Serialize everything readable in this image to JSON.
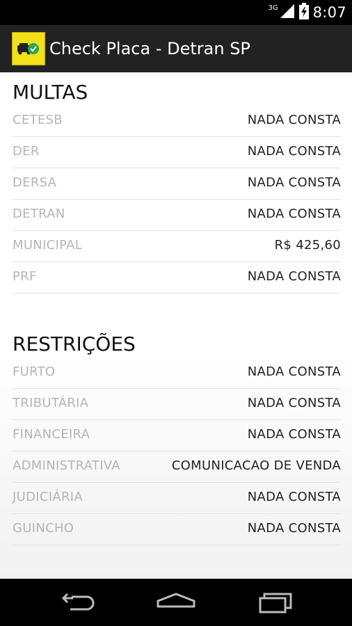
{
  "status_bar": {
    "network": "3G",
    "time": "8:07",
    "icons": [
      "signal-icon",
      "battery-icon"
    ]
  },
  "app_bar": {
    "title": "Check Placa - Detran SP",
    "icon": "car-check-icon",
    "icon_color": "#f2e11a"
  },
  "multas": {
    "title": "MULTAS",
    "rows": [
      {
        "label": "CETESB",
        "value": "NADA CONSTA"
      },
      {
        "label": "DER",
        "value": "NADA CONSTA"
      },
      {
        "label": "DERSA",
        "value": "NADA CONSTA"
      },
      {
        "label": "DETRAN",
        "value": "NADA CONSTA"
      },
      {
        "label": "MUNICIPAL",
        "value": "R$ 425,60"
      },
      {
        "label": "PRF",
        "value": "NADA CONSTA"
      }
    ]
  },
  "restricoes": {
    "title": "RESTRIÇÕES",
    "rows": [
      {
        "label": "FURTO",
        "value": "NADA CONSTA"
      },
      {
        "label": "TRIBUTÁRIA",
        "value": "NADA CONSTA"
      },
      {
        "label": "FINANCEIRA",
        "value": "NADA CONSTA"
      },
      {
        "label": "ADMINISTRATIVA",
        "value": "COMUNICACAO DE VENDA"
      },
      {
        "label": "JUDICIÁRIA",
        "value": "NADA CONSTA"
      },
      {
        "label": "GUINCHO",
        "value": "NADA CONSTA"
      }
    ]
  },
  "nav_bar": {
    "buttons": [
      "back-icon",
      "home-icon",
      "recents-icon"
    ]
  }
}
